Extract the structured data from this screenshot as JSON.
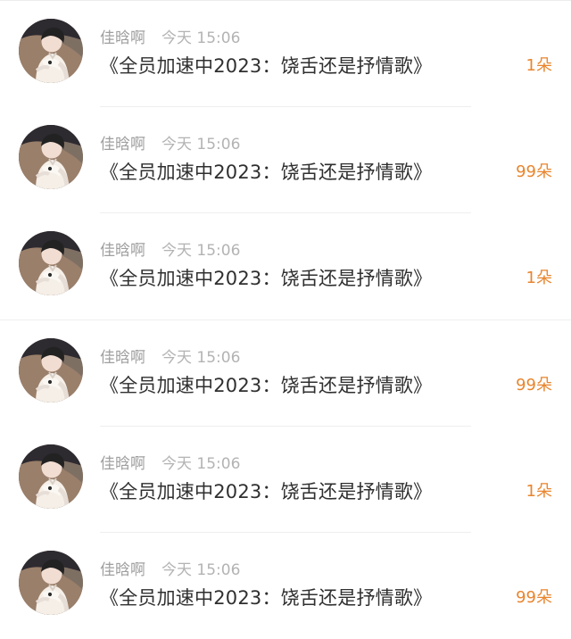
{
  "items": [
    {
      "username": "佳晗啊",
      "time": "今天 15:06",
      "title": "《全员加速中2023：饶舌还是抒情歌》",
      "gift": "1朵"
    },
    {
      "username": "佳晗啊",
      "time": "今天 15:06",
      "title": "《全员加速中2023：饶舌还是抒情歌》",
      "gift": "99朵"
    },
    {
      "username": "佳晗啊",
      "time": "今天 15:06",
      "title": "《全员加速中2023：饶舌还是抒情歌》",
      "gift": "1朵"
    },
    {
      "username": "佳晗啊",
      "time": "今天 15:06",
      "title": "《全员加速中2023：饶舌还是抒情歌》",
      "gift": "99朵"
    },
    {
      "username": "佳晗啊",
      "time": "今天 15:06",
      "title": "《全员加速中2023：饶舌还是抒情歌》",
      "gift": "1朵"
    },
    {
      "username": "佳晗啊",
      "time": "今天 15:06",
      "title": "《全员加速中2023：饶舌还是抒情歌》",
      "gift": "99朵"
    }
  ],
  "colors": {
    "gift": "#e8852d",
    "title": "#2f2f2f",
    "meta": "#a9a9a9"
  },
  "icons": {
    "avatar": "user-avatar"
  }
}
